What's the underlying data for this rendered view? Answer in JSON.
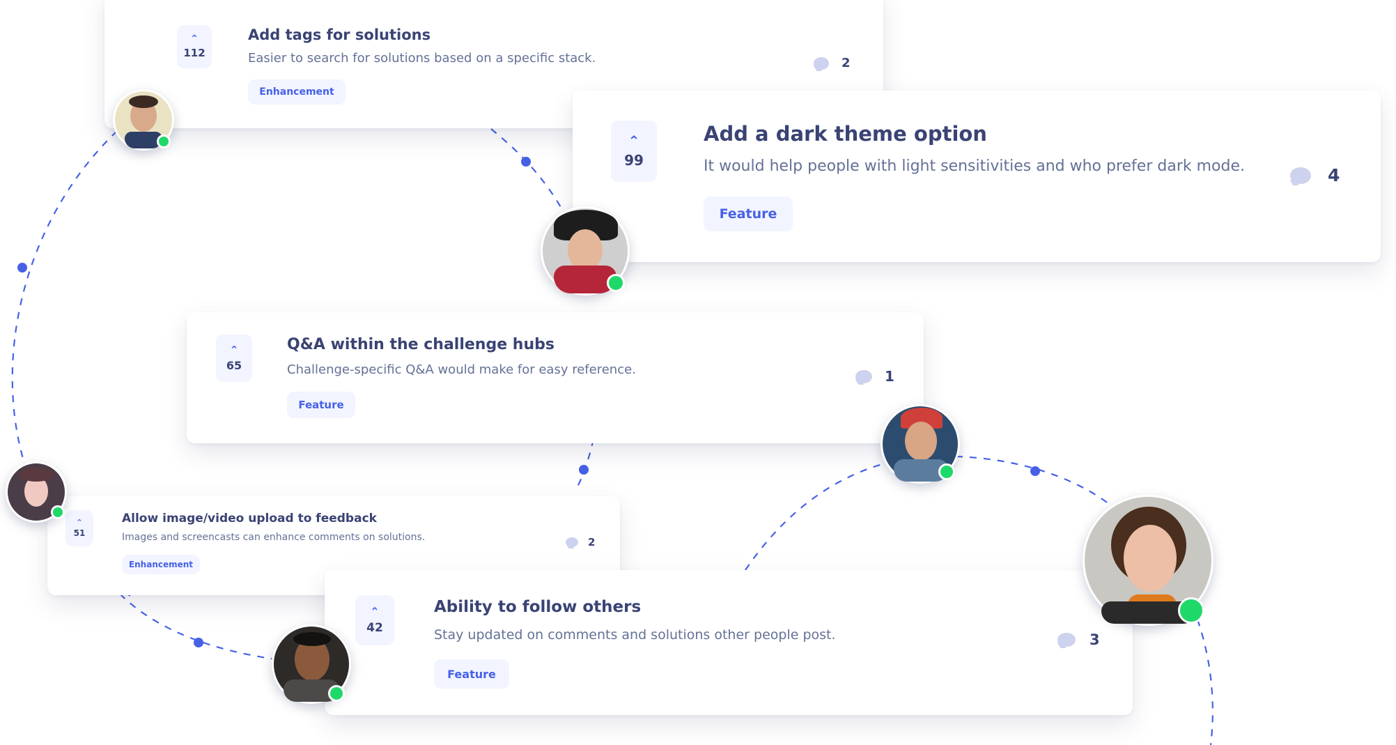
{
  "colors": {
    "accent": "#4661E6",
    "tag_bg": "#F2F4FF",
    "title": "#3A4374",
    "body": "#647196",
    "online": "#1FD86A"
  },
  "feedback": [
    {
      "title": "Add tags for solutions",
      "description": "Easier to search for solutions based on a specific stack.",
      "votes": "112",
      "tag": "Enhancement",
      "comments": "2"
    },
    {
      "title": "Add a dark theme option",
      "description": "It would help people with light sensitivities and who prefer dark mode.",
      "votes": "99",
      "tag": "Feature",
      "comments": "4"
    },
    {
      "title": "Q&A within the challenge hubs",
      "description": "Challenge-specific Q&A would make for easy reference.",
      "votes": "65",
      "tag": "Feature",
      "comments": "1"
    },
    {
      "title": "Allow image/video upload to feedback",
      "description": "Images and screencasts can enhance comments on solutions.",
      "votes": "51",
      "tag": "Enhancement",
      "comments": "2"
    },
    {
      "title": "Ability to follow others",
      "description": "Stay updated on comments and solutions other people post.",
      "votes": "42",
      "tag": "Feature",
      "comments": "3"
    }
  ],
  "icons": {
    "upvote": "chevron-up-icon",
    "comments": "comment-bubble-icon",
    "online": "online-status-icon"
  }
}
